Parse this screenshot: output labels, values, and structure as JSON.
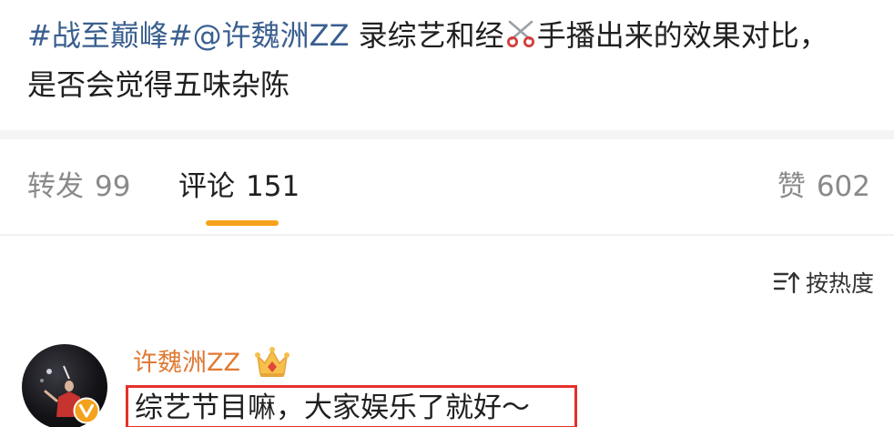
{
  "post": {
    "hashtag_1": "#战至巅峰#",
    "mention": "@许魏洲ZZ",
    "text_a": " 录综艺和经",
    "scissors_icon": "scissors-icon",
    "text_b": "手播出来的效果对比，",
    "text_line2": "是否会觉得五味杂陈"
  },
  "tabs": {
    "repost_label": "转发",
    "repost_count": "99",
    "comment_label": "评论",
    "comment_count": "151",
    "like_label": "赞",
    "like_count": "602"
  },
  "sort": {
    "label": "按热度",
    "icon": "sort-icon"
  },
  "comment": {
    "author": "许魏洲ZZ",
    "text": "综艺节目嘛，大家娱乐了就好～",
    "badge_icon": "verified-v-icon",
    "crown_icon": "crown-icon"
  },
  "colors": {
    "link": "#3a5f8f",
    "accent_underline": "#f7a21b",
    "author_name": "#e07a34",
    "highlight_box": "#e5302c"
  }
}
